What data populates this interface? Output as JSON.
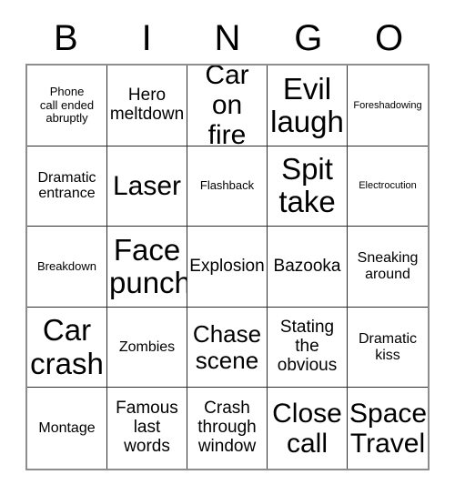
{
  "card": {
    "title": "BINGO",
    "background_color": "#ffffff",
    "text_color": "#000000",
    "outer_border_color": "#8d8d8d",
    "inner_grid_line_color": "#2b2b2b"
  },
  "header": {
    "letters": [
      "B",
      "I",
      "N",
      "G",
      "O"
    ]
  },
  "grid": {
    "columns": 5,
    "rows": 5,
    "cells": [
      {
        "text": "Phone\ncall ended\nabruptly",
        "size": "fs-xxs",
        "column": "B",
        "row": 1
      },
      {
        "text": "Hero\nmeltdown",
        "size": "fs-sm",
        "column": "I",
        "row": 1
      },
      {
        "text": "Car\non fire",
        "size": "fs-xl",
        "column": "N",
        "row": 1
      },
      {
        "text": "Evil\nlaugh",
        "size": "fs-xxl",
        "column": "G",
        "row": 1
      },
      {
        "text": "Foreshadowing",
        "size": "fs-tiny",
        "column": "O",
        "row": 1
      },
      {
        "text": "Dramatic\nentrance",
        "size": "fs-xs",
        "column": "B",
        "row": 2
      },
      {
        "text": "Laser",
        "size": "fs-xl",
        "column": "I",
        "row": 2
      },
      {
        "text": "Flashback",
        "size": "fs-xxs",
        "column": "N",
        "row": 2
      },
      {
        "text": "Spit\ntake",
        "size": "fs-xxl",
        "column": "G",
        "row": 2
      },
      {
        "text": "Electrocution",
        "size": "fs-tiny",
        "column": "O",
        "row": 2
      },
      {
        "text": "Breakdown",
        "size": "fs-xxs",
        "column": "B",
        "row": 3
      },
      {
        "text": "Face\npunch",
        "size": "fs-xxl",
        "column": "I",
        "row": 3
      },
      {
        "text": "Explosion",
        "size": "fs-sm",
        "column": "N",
        "row": 3
      },
      {
        "text": "Bazooka",
        "size": "fs-sm",
        "column": "G",
        "row": 3
      },
      {
        "text": "Sneaking\naround",
        "size": "fs-xs",
        "column": "O",
        "row": 3
      },
      {
        "text": "Car\ncrash",
        "size": "fs-xxl",
        "column": "B",
        "row": 4
      },
      {
        "text": "Zombies",
        "size": "fs-xs",
        "column": "I",
        "row": 4
      },
      {
        "text": "Chase\nscene",
        "size": "fs-lg",
        "column": "N",
        "row": 4
      },
      {
        "text": "Stating\nthe\nobvious",
        "size": "fs-sm",
        "column": "G",
        "row": 4
      },
      {
        "text": "Dramatic\nkiss",
        "size": "fs-xs",
        "column": "O",
        "row": 4
      },
      {
        "text": "Montage",
        "size": "fs-xs",
        "column": "B",
        "row": 5
      },
      {
        "text": "Famous\nlast\nwords",
        "size": "fs-sm",
        "column": "I",
        "row": 5
      },
      {
        "text": "Crash\nthrough\nwindow",
        "size": "fs-sm",
        "column": "N",
        "row": 5
      },
      {
        "text": "Close\ncall",
        "size": "fs-xl",
        "column": "G",
        "row": 5
      },
      {
        "text": "Space\nTravel",
        "size": "fs-xl",
        "column": "O",
        "row": 5
      }
    ]
  }
}
